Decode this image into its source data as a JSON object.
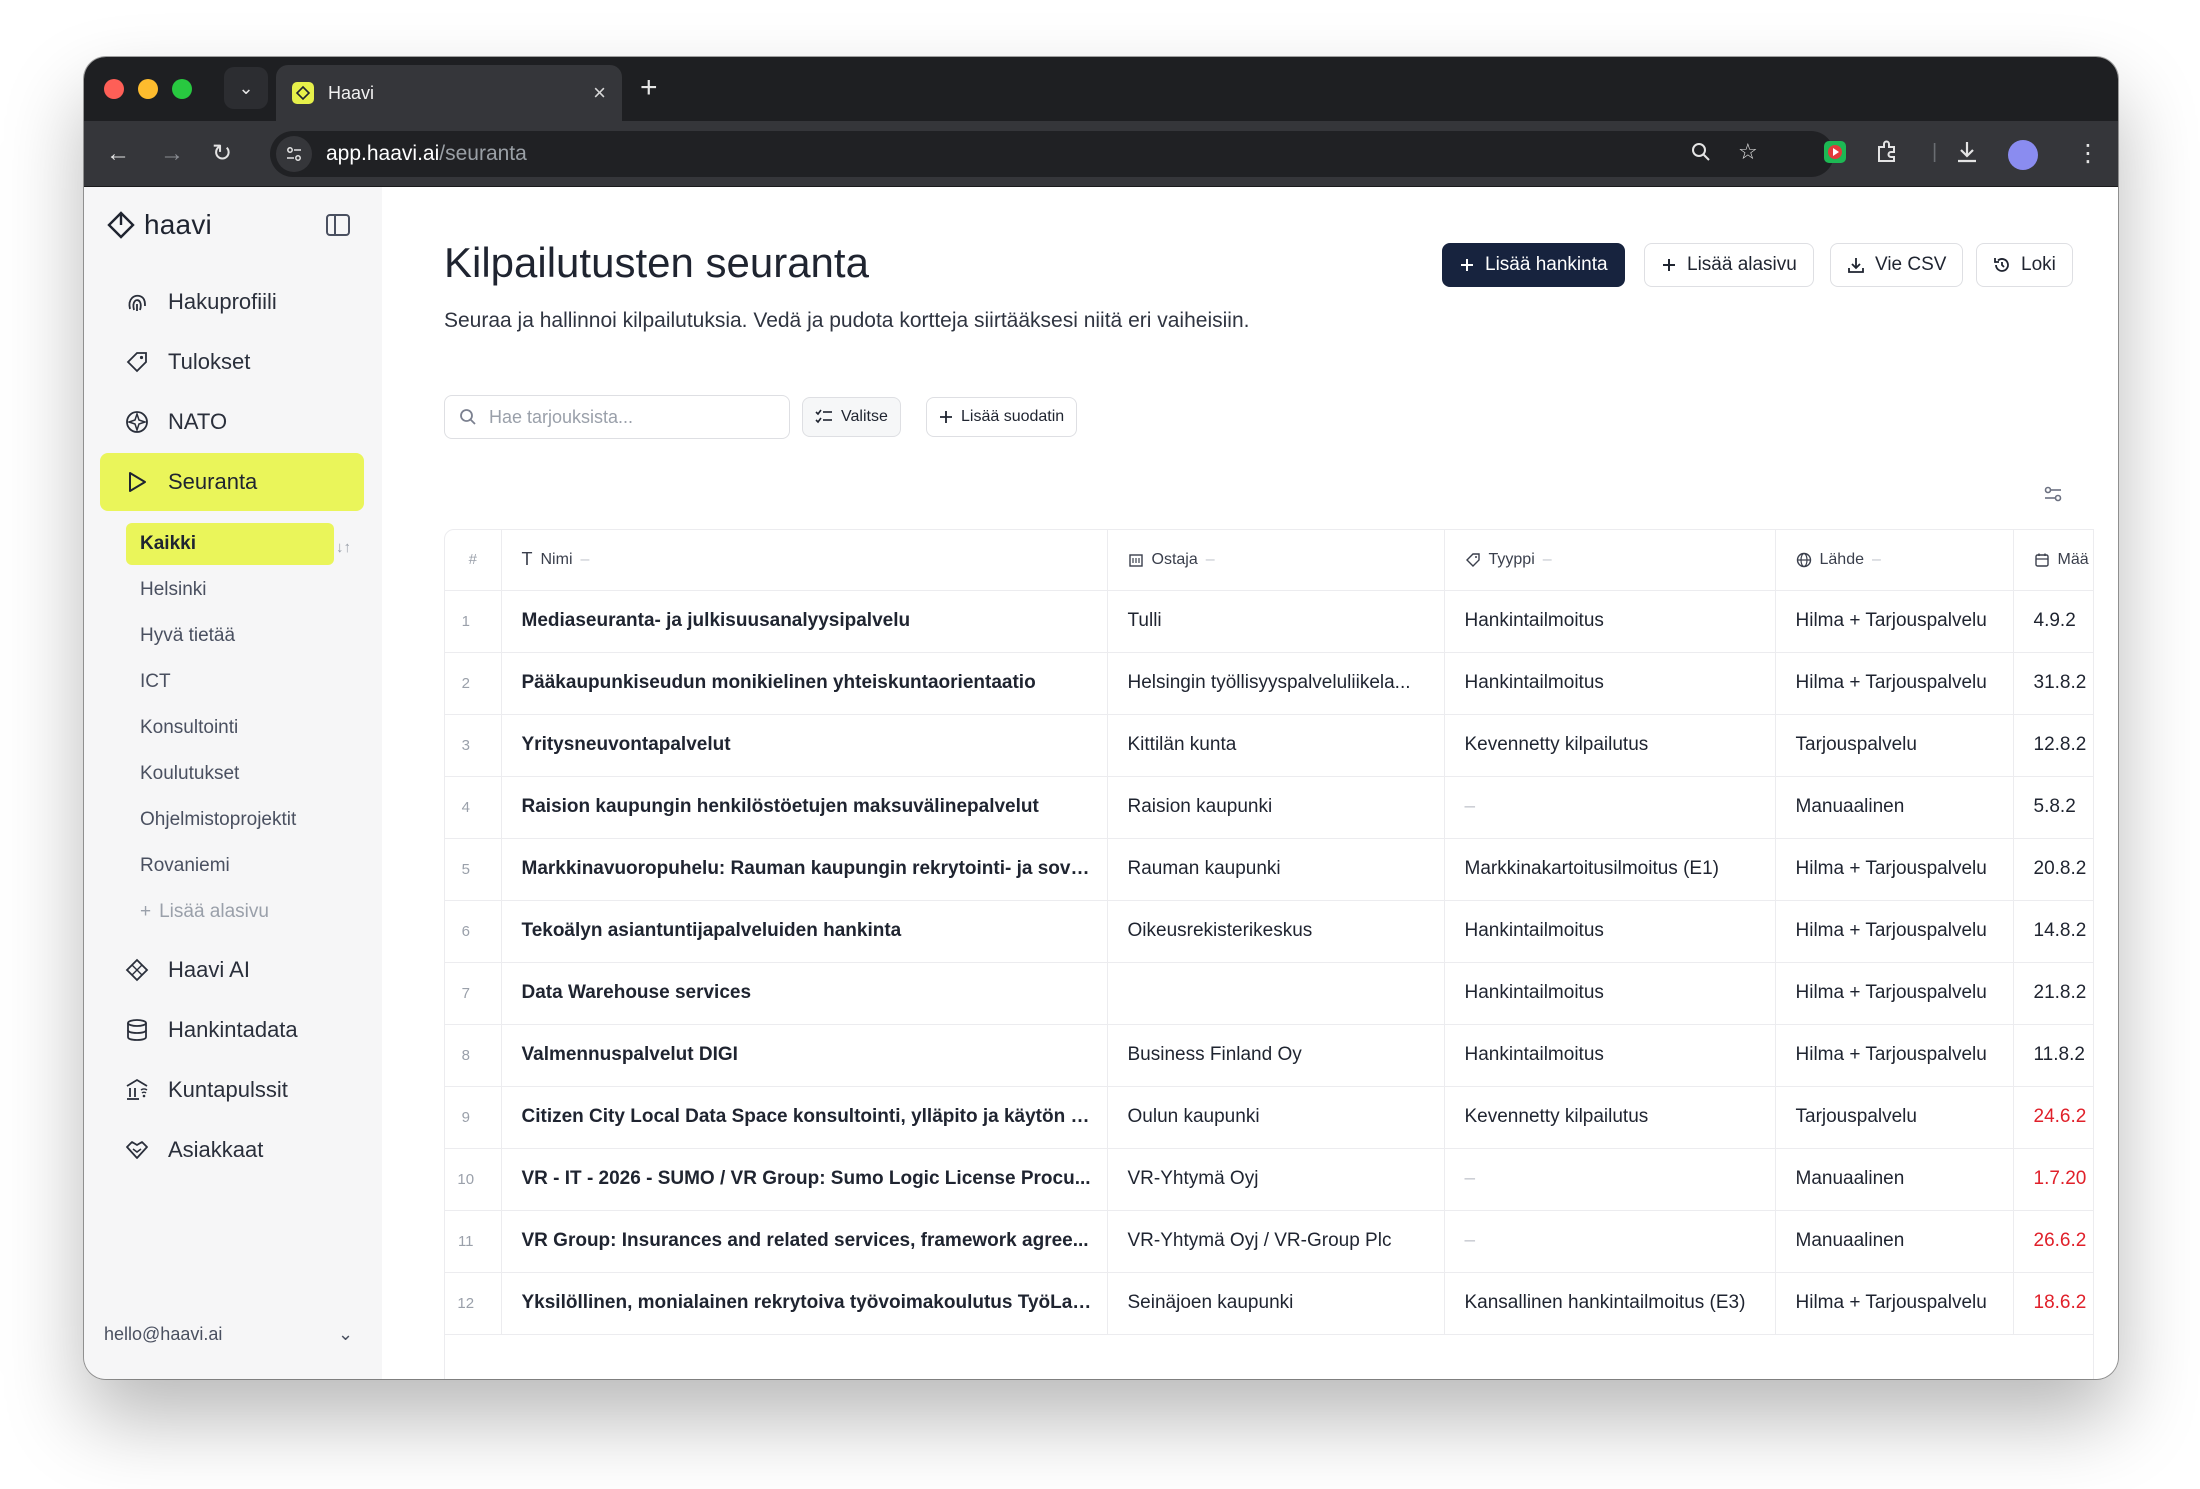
{
  "browser": {
    "tab_title": "Haavi",
    "url_host": "app.haavi.ai",
    "url_path": "/seuranta"
  },
  "sidebar": {
    "brand": "haavi",
    "nav": [
      {
        "label": "Hakuprofiili",
        "icon": "fingerprint-icon"
      },
      {
        "label": "Tulokset",
        "icon": "tag-icon"
      },
      {
        "label": "NATO",
        "icon": "compass-icon"
      },
      {
        "label": "Seuranta",
        "icon": "play-outline-icon",
        "active": true
      }
    ],
    "subpages": [
      "Kaikki",
      "Helsinki",
      "Hyvä tietää",
      "ICT",
      "Konsultointi",
      "Koulutukset",
      "Ohjelmistoprojektit",
      "Rovaniemi"
    ],
    "add_subpage": "Lisää alasivu",
    "nav_bottom": [
      {
        "label": "Haavi AI",
        "icon": "sparkle-icon"
      },
      {
        "label": "Hankintadata",
        "icon": "database-icon"
      },
      {
        "label": "Kuntapulssit",
        "icon": "municipal-icon"
      },
      {
        "label": "Asiakkaat",
        "icon": "handshake-icon"
      }
    ],
    "user_email": "hello@haavi.ai"
  },
  "header": {
    "title": "Kilpailutusten seuranta",
    "subtitle": "Seuraa ja hallinnoi kilpailutuksia. Vedä ja pudota kortteja siirtääksesi niitä eri vaiheisiin.",
    "buttons": {
      "add_procurement": "Lisää hankinta",
      "add_subpage": "Lisää alasivu",
      "export_csv": "Vie CSV",
      "log": "Loki"
    }
  },
  "filters": {
    "search_placeholder": "Hae tarjouksista...",
    "select": "Valitse",
    "add_filter": "Lisää suodatin"
  },
  "table": {
    "headers": {
      "num": "#",
      "name": "Nimi",
      "buyer": "Ostaja",
      "type": "Tyyppi",
      "source": "Lähde",
      "deadline": "Mää"
    },
    "rows": [
      {
        "n": "1",
        "name": "Mediaseuranta- ja julkisuusanalyysipalvelu",
        "buyer": "Tulli",
        "type": "Hankintailmoitus",
        "source": "Hilma + Tarjouspalvelu",
        "date": "4.9.2",
        "red": false
      },
      {
        "n": "2",
        "name": "Pääkaupunkiseudun monikielinen yhteiskuntaorientaatio",
        "buyer": "Helsingin työllisyyspalveluliikela...",
        "type": "Hankintailmoitus",
        "source": "Hilma + Tarjouspalvelu",
        "date": "31.8.2",
        "red": false
      },
      {
        "n": "3",
        "name": "Yritysneuvontapalvelut",
        "buyer": "Kittilän kunta",
        "type": "Kevennetty kilpailutus",
        "source": "Tarjouspalvelu",
        "date": "12.8.2",
        "red": false
      },
      {
        "n": "4",
        "name": "Raision kaupungin henkilöstöetujen maksuvälinepalvelut",
        "buyer": "Raision kaupunki",
        "type": "–",
        "source": "Manuaalinen",
        "date": "5.8.2",
        "red": false
      },
      {
        "n": "5",
        "name": "Markkinavuoropuhelu: Rauman kaupungin rekrytointi- ja sovel...",
        "buyer": "Rauman kaupunki",
        "type": "Markkinakartoitusilmoitus (E1)",
        "source": "Hilma + Tarjouspalvelu",
        "date": "20.8.2",
        "red": false
      },
      {
        "n": "6",
        "name": "Tekoälyn asiantuntijapalveluiden hankinta",
        "buyer": "Oikeusrekisterikeskus",
        "type": "Hankintailmoitus",
        "source": "Hilma + Tarjouspalvelu",
        "date": "14.8.2",
        "red": false
      },
      {
        "n": "7",
        "name": "Data Warehouse services",
        "buyer": "",
        "type": "Hankintailmoitus",
        "source": "Hilma + Tarjouspalvelu",
        "date": "21.8.2",
        "red": false
      },
      {
        "n": "8",
        "name": "Valmennuspalvelut DIGI",
        "buyer": "Business Finland Oy",
        "type": "Hankintailmoitus",
        "source": "Hilma + Tarjouspalvelu",
        "date": "11.8.2",
        "red": false
      },
      {
        "n": "9",
        "name": "Citizen City Local Data Space konsultointi, ylläpito ja käytön t...",
        "buyer": "Oulun kaupunki",
        "type": "Kevennetty kilpailutus",
        "source": "Tarjouspalvelu",
        "date": "24.6.2",
        "red": true
      },
      {
        "n": "10",
        "name": "VR - IT - 2026 - SUMO / VR Group: Sumo Logic License Procu...",
        "buyer": "VR-Yhtymä Oyj",
        "type": "–",
        "source": "Manuaalinen",
        "date": "1.7.20",
        "red": true
      },
      {
        "n": "11",
        "name": "VR Group: Insurances and related services, framework agree...",
        "buyer": "VR-Yhtymä Oyj / VR-Group Plc",
        "type": "–",
        "source": "Manuaalinen",
        "date": "26.6.2",
        "red": true
      },
      {
        "n": "12",
        "name": "Yksilöllinen, monialainen rekrytoiva työvoimakoulutus TyöLak...",
        "buyer": "Seinäjoen kaupunki",
        "type": "Kansallinen hankintailmoitus (E3)",
        "source": "Hilma + Tarjouspalvelu",
        "date": "18.6.2",
        "red": true
      }
    ]
  }
}
